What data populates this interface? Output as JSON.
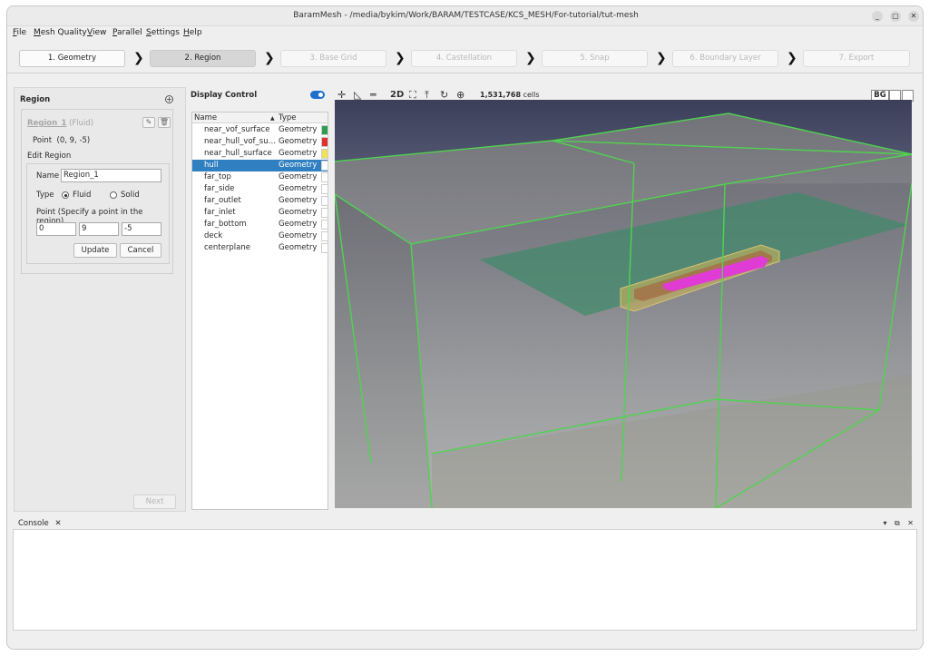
{
  "window": {
    "title": "BaramMesh - /media/bykim/Work/BARAM/TESTCASE/KCS_MESH/For-tutorial/tut-mesh",
    "controls": [
      "_",
      "▢",
      "✕"
    ]
  },
  "menu": [
    "File",
    "Mesh Quality",
    "View",
    "Parallel",
    "Settings",
    "Help"
  ],
  "steps": [
    {
      "label": "1. Geometry",
      "state": "normal"
    },
    {
      "label": "2. Region",
      "state": "active"
    },
    {
      "label": "3. Base Grid",
      "state": "disabled"
    },
    {
      "label": "4. Castellation",
      "state": "disabled"
    },
    {
      "label": "5. Snap",
      "state": "disabled"
    },
    {
      "label": "6. Boundary Layer",
      "state": "disabled"
    },
    {
      "label": "7. Export",
      "state": "disabled"
    }
  ],
  "region_panel": {
    "title": "Region",
    "region_name": "Region_1",
    "region_type": "(Fluid)",
    "point_label": "Point",
    "point_value": "(0, 9, -5)",
    "edit_title": "Edit Region",
    "name_label": "Name",
    "name_value": "Region_1",
    "type_label": "Type",
    "type_fluid": "Fluid",
    "type_solid": "Solid",
    "point_hint": "Point (Specify a point in the region)",
    "px": "0",
    "py": "9",
    "pz": "-5",
    "update_label": "Update",
    "cancel_label": "Cancel",
    "next_label": "Next"
  },
  "display_control": {
    "title": "Display Control",
    "col_name": "Name",
    "col_type": "Type",
    "rows": [
      {
        "name": "near_vof_surface",
        "type": "Geometry",
        "color": "#2e9e4f",
        "selected": false
      },
      {
        "name": "near_hull_vof_surface",
        "type": "Geometry",
        "color": "#e03131",
        "selected": false
      },
      {
        "name": "near_hull_surface",
        "type": "Geometry",
        "color": "#f0e05a",
        "selected": false
      },
      {
        "name": "hull",
        "type": "Geometry",
        "color": "#ffffff",
        "selected": true
      },
      {
        "name": "far_top",
        "type": "Geometry",
        "color": "#ffffff",
        "selected": false
      },
      {
        "name": "far_side",
        "type": "Geometry",
        "color": "#ffffff",
        "selected": false
      },
      {
        "name": "far_outlet",
        "type": "Geometry",
        "color": "#ffffff",
        "selected": false
      },
      {
        "name": "far_inlet",
        "type": "Geometry",
        "color": "#ffffff",
        "selected": false
      },
      {
        "name": "far_bottom",
        "type": "Geometry",
        "color": "#ffffff",
        "selected": false
      },
      {
        "name": "deck",
        "type": "Geometry",
        "color": "#ffffff",
        "selected": false
      },
      {
        "name": "centerplane",
        "type": "Geometry",
        "color": "#ffffff",
        "selected": false
      }
    ]
  },
  "toolbar3d": {
    "mode_2d": "2D",
    "cells_count": "1,531,768",
    "cells_unit": "cells",
    "bg_label": "BG"
  },
  "console": {
    "tab_label": "Console",
    "close": "✕"
  }
}
